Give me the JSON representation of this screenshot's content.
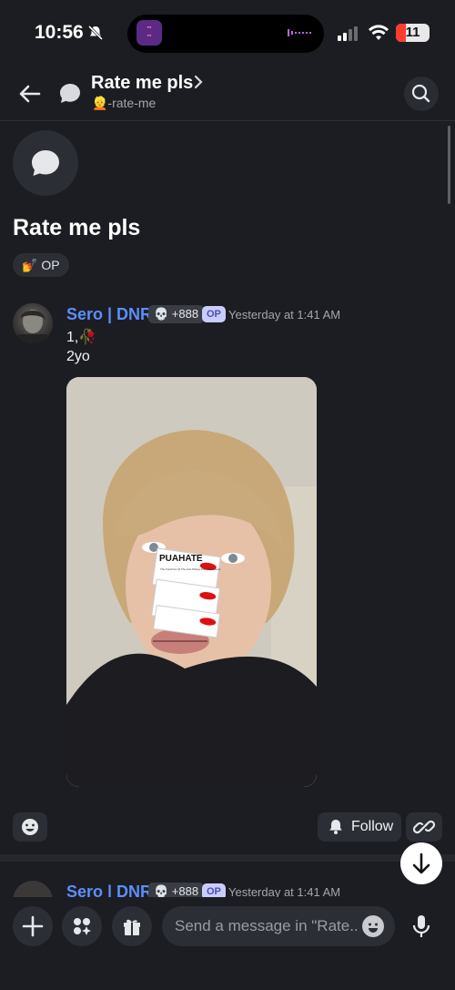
{
  "status": {
    "time": "10:56",
    "battery": "11"
  },
  "header": {
    "title": "Rate me pls",
    "channel": "👱-rate-me"
  },
  "thread": {
    "title": "Rate me pls",
    "tag": "💅 OP"
  },
  "message": {
    "author": "Sero | DNR",
    "badge": "💀 +888",
    "op": "OP",
    "timestamp": "Yesterday at 1:41 AM",
    "line1": "1,🥀",
    "line2": "2yo"
  },
  "photo": {
    "sticker_title": "PUAHATE",
    "sticker_caption": "The Forefront Of The Anti-Pickup Artist Movement"
  },
  "actions": {
    "follow_label": "Follow"
  },
  "message2": {
    "author": "Sero | DNR",
    "badge": "💀 +888",
    "op": "OP",
    "timestamp": "Yesterday at 1:41 AM"
  },
  "composer": {
    "placeholder": "Send a message in \"Rate.."
  },
  "colors": {
    "background": "#1c1d22",
    "author": "#5b8ff9",
    "surface": "#2c2e35"
  },
  "icons": [
    "back-arrow-icon",
    "thread-icon",
    "search-icon",
    "chat-bubble-icon",
    "emoji-icon",
    "bell-icon",
    "link-icon",
    "arrow-down-icon",
    "plus-icon",
    "apps-icon",
    "gift-icon",
    "mic-icon"
  ]
}
